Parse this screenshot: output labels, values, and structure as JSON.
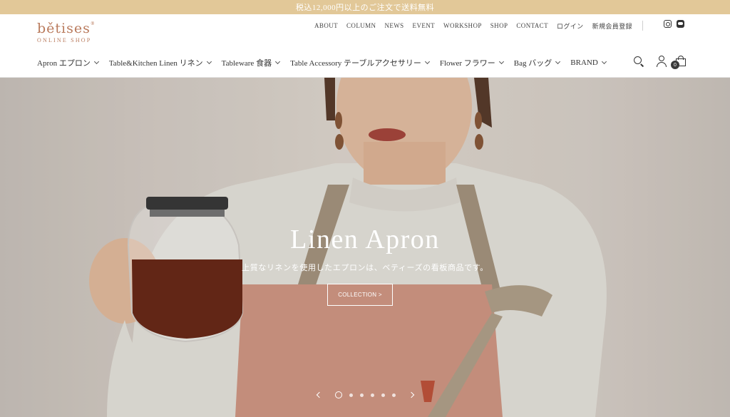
{
  "announcement": "税込12,000円以上のご注文で送料無料",
  "logo": {
    "name": "bětises",
    "sub": "ONLINE SHOP",
    "mark": "®"
  },
  "utility_links": [
    "ABOUT",
    "COLUMN",
    "NEWS",
    "EVENT",
    "WORKSHOP",
    "SHOP",
    "CONTACT",
    "ログイン",
    "新規会員登録"
  ],
  "nav": [
    {
      "label": "Apron エプロン"
    },
    {
      "label": "Table&Kitchen Linen リネン"
    },
    {
      "label": "Tableware 食器"
    },
    {
      "label": "Table Accessory テーブルアクセサリー"
    },
    {
      "label": "Flower フラワー"
    },
    {
      "label": "Bag バッグ"
    },
    {
      "label": "BRAND"
    }
  ],
  "cart": {
    "count": "0"
  },
  "hero": {
    "title": "Linen Apron",
    "subtitle": "上質なリネンを使用したエプロンは、ベティーズの看板商品です。",
    "button": "COLLECTION >"
  },
  "slider": {
    "total": 6,
    "active": 1
  },
  "colors": {
    "announcement_bg": "#e2c898",
    "logo": "#b97a5c",
    "apron": "#d49a86",
    "strap": "#a89680"
  }
}
